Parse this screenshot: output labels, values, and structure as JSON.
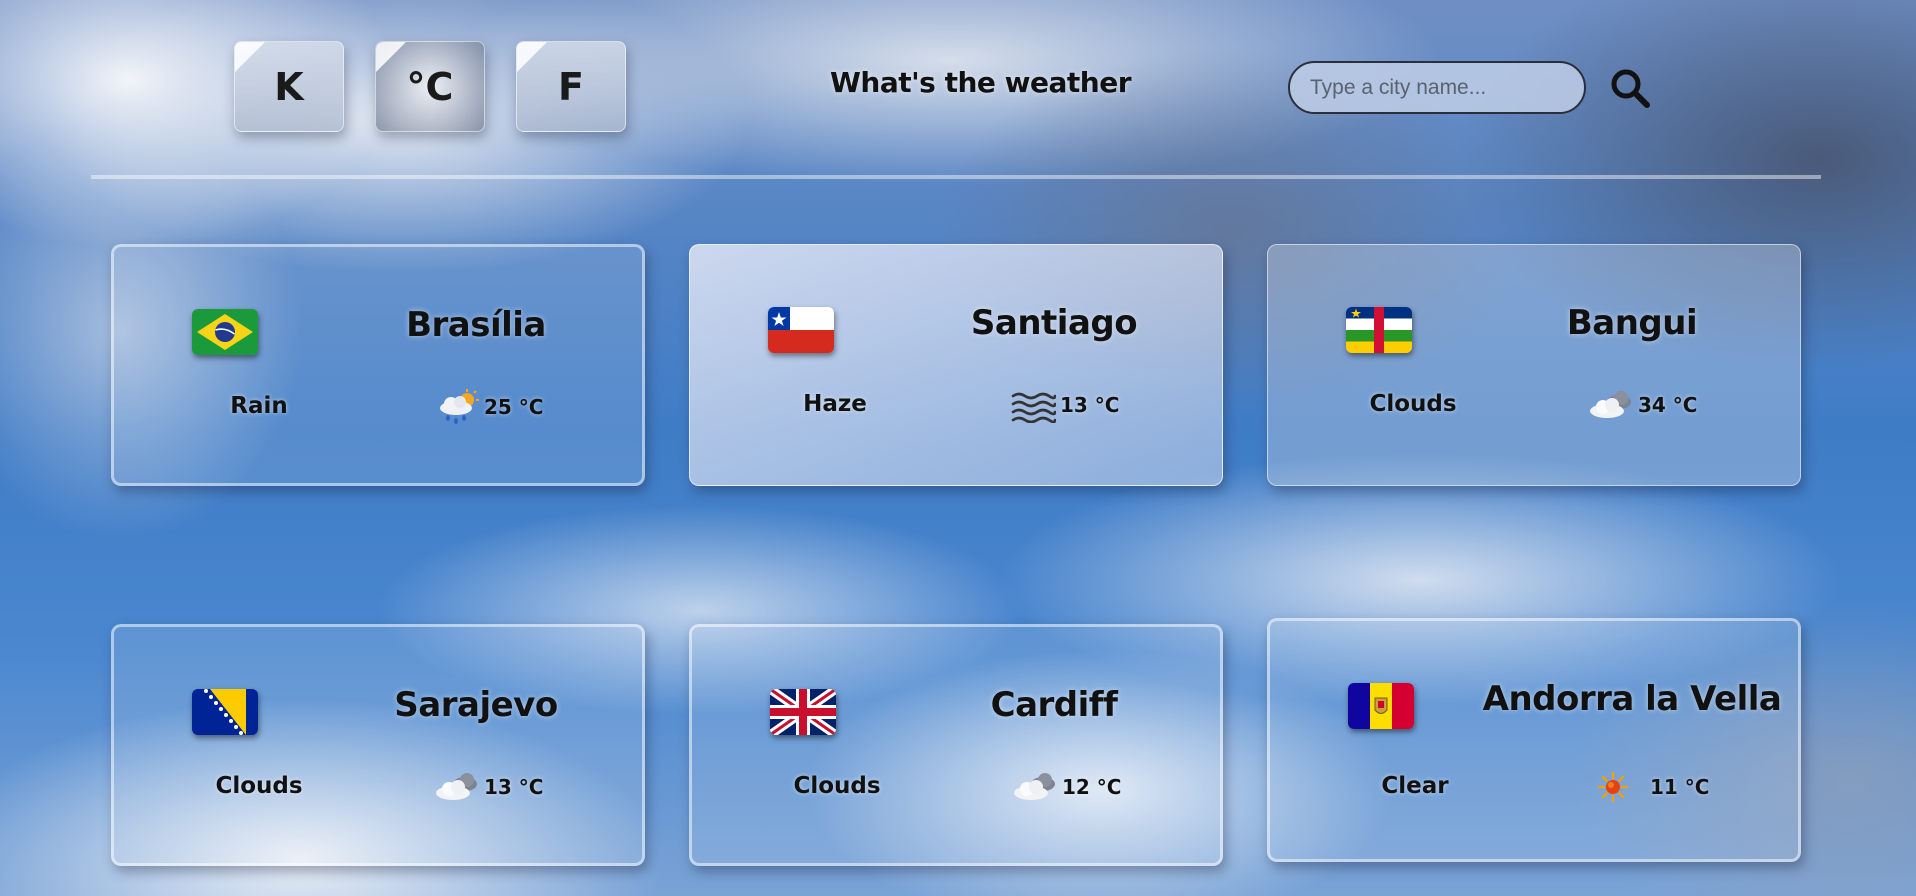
{
  "header": {
    "unit_buttons": [
      {
        "label": "K",
        "active": false
      },
      {
        "label": "°C",
        "active": true
      },
      {
        "label": "F",
        "active": false
      }
    ],
    "title": "What's the weather",
    "search": {
      "value": "",
      "placeholder": "Type a city name..."
    }
  },
  "cities": [
    {
      "name": "Brasília",
      "flag": "brazil-flag",
      "condition": "Rain",
      "weather_icon": "rain-sun-icon",
      "temperature": "25 °C"
    },
    {
      "name": "Santiago",
      "flag": "chile-flag",
      "condition": "Haze",
      "weather_icon": "haze-icon",
      "temperature": "13 °C"
    },
    {
      "name": "Bangui",
      "flag": "central-african-republic-flag",
      "condition": "Clouds",
      "weather_icon": "clouds-icon",
      "temperature": "34 °C"
    },
    {
      "name": "Sarajevo",
      "flag": "bosnia-herzegovina-flag",
      "condition": "Clouds",
      "weather_icon": "clouds-icon",
      "temperature": "13 °C"
    },
    {
      "name": "Cardiff",
      "flag": "united-kingdom-flag",
      "condition": "Clouds",
      "weather_icon": "clouds-icon",
      "temperature": "12 °C"
    },
    {
      "name": "Andorra la Vella",
      "flag": "andorra-flag",
      "condition": "Clear",
      "weather_icon": "sun-icon",
      "temperature": "11 °C"
    }
  ]
}
